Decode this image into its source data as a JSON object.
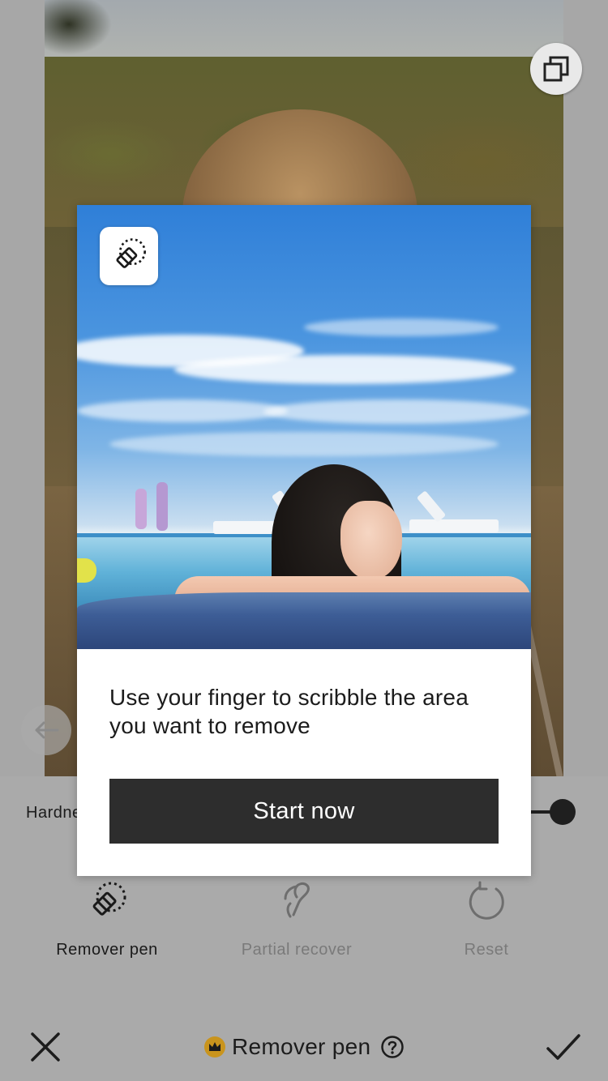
{
  "dialog": {
    "instruction": "Use your finger to scribble the area you want to remove",
    "start_button": "Start now",
    "badge_icon": "remover-pen-icon"
  },
  "panel": {
    "hardness_label": "Hardness",
    "slider_value_percent": 100,
    "tools": [
      {
        "label": "Remover pen",
        "icon": "remover-pen-icon",
        "active": true
      },
      {
        "label": "Partial recover",
        "icon": "partial-recover-icon",
        "active": false
      },
      {
        "label": "Reset",
        "icon": "reset-icon",
        "active": false
      }
    ]
  },
  "bottom_bar": {
    "title": "Remover pen",
    "crown_icon": "crown-icon",
    "help_icon": "help-icon",
    "close_icon": "close-icon",
    "confirm_icon": "checkmark-icon"
  },
  "colors": {
    "panel_bg": "#aaaaaa",
    "dialog_button_bg": "#2d2d2d",
    "crown_badge": "#c9941d"
  }
}
